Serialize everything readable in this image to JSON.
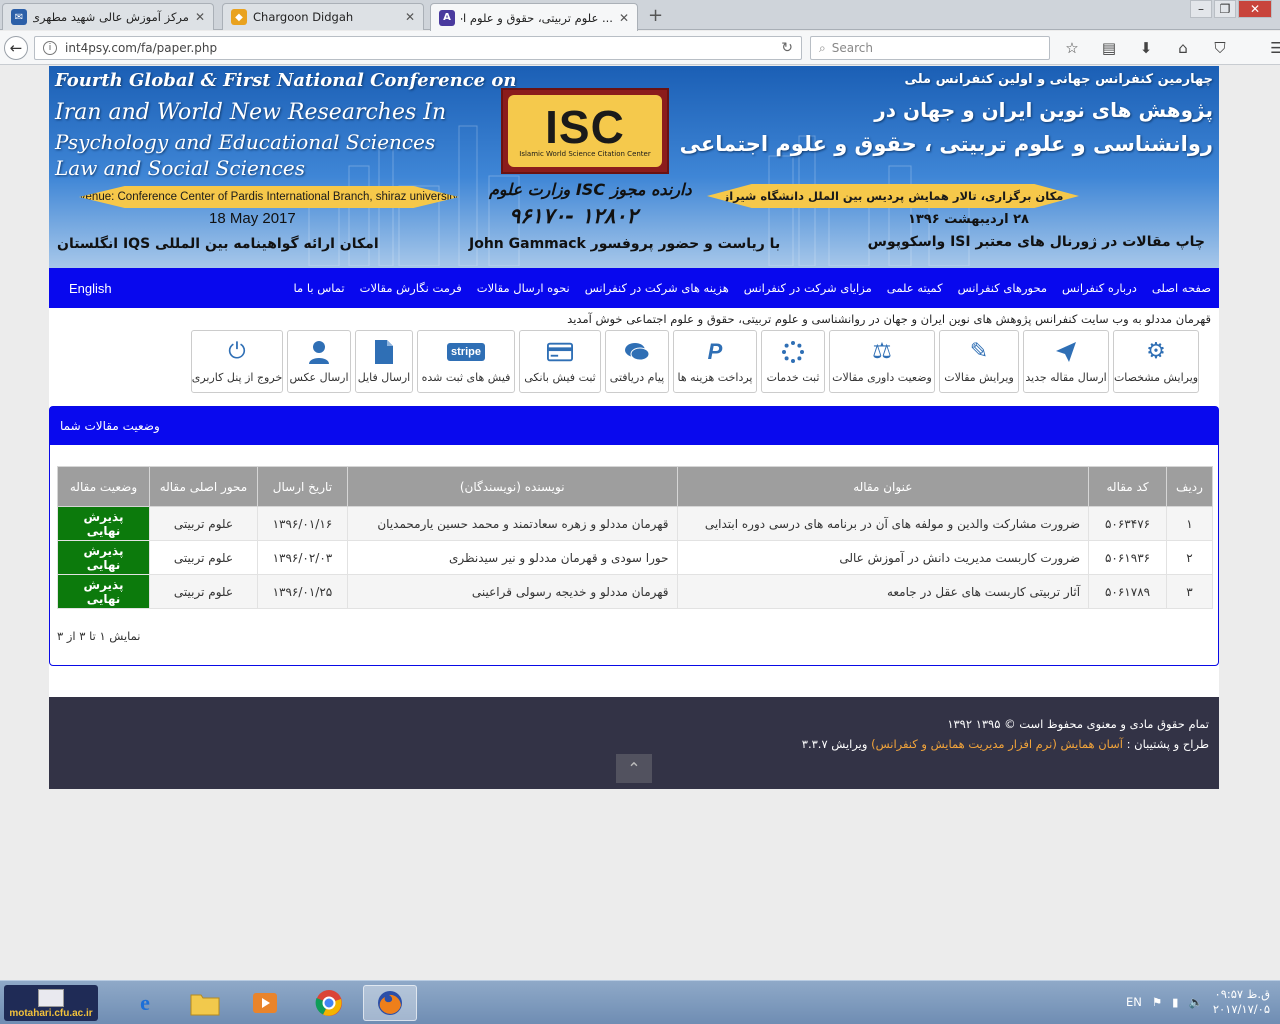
{
  "browser": {
    "tabs": [
      {
        "title": "مرکز آموزش عالی شهید مطهری خوی"
      },
      {
        "title": "Chargoon Didgah"
      },
      {
        "title": "... علوم تربیتی، حقوق و علوم اجتماعی",
        "active": true
      }
    ],
    "url": "int4psy.com/fa/paper.php",
    "search_placeholder": "Search"
  },
  "banner": {
    "en_line1": "Fourth Global & First National Conference on",
    "en_line2": "Iran and World New Researches In",
    "en_line3": "Psychology and Educational Sciences",
    "en_line4": "Law and Social Sciences",
    "en_venue": "venue: Conference Center of Pardis International Branch, shiraz university",
    "en_date": "18 May 2017",
    "iqs": "امکان ارائه گواهینامه بین المللی IQS انگلستان",
    "logo_text": "ISC",
    "logo_sub": "Islamic World Science Citation Center",
    "fa_line1": "چهارمین کنفرانس جهانی و اولین کنفرانس ملی",
    "fa_line2": "پژوهش های نوین ایران و جهان در",
    "fa_line3": "روانشناسی و علوم تربیتی ، حقوق و علوم اجتماعی",
    "fa_venue": "مکان برگزاری، تالار همایش  پردیس بین الملل دانشگاه شیراز",
    "fa_date": "۲۸ اردیبهشت ۱۳۹۶",
    "fa_pub": "چاپ مقالات در ژورنال های معتبر ISI واسکوپوس",
    "fa_license": "دارنده مجوز ISC وزارت علوم",
    "fa_license_num": "۱۲۸۰۲ -۹۶۱۷۰",
    "fa_presidency": "با ریاست و حضور پروفسور John Gammack"
  },
  "mainnav": {
    "english": "English",
    "items": [
      "صفحه اصلی",
      "درباره کنفرانس",
      "محورهای کنفرانس",
      "کمیته علمی",
      "مزایای شرکت در کنفرانس",
      "هزینه های شرکت در کنفرانس",
      "نحوه ارسال مقالات",
      "فرمت نگارش مقالات",
      "تماس با ما"
    ]
  },
  "welcome": "قهرمان مددلو به وب سایت کنفرانس پژوهش های نوین ایران و جهان در روانشناسی و علوم تربیتی، حقوق و علوم اجتماعی خوش آمدید",
  "actions": [
    {
      "label": "ویرایش مشخصات",
      "icon": "gear-icon"
    },
    {
      "label": "ارسال مقاله جدید",
      "icon": "paper-plane-icon"
    },
    {
      "label": "ویرایش مقالات",
      "icon": "edit-icon"
    },
    {
      "label": "وضعیت داوری مقالات",
      "icon": "balance-scale-icon"
    },
    {
      "label": "ثبت خدمات",
      "icon": "spinner-icon"
    },
    {
      "label": "پرداخت هزینه ها",
      "icon": "paypal-icon"
    },
    {
      "label": "پیام دریافتی",
      "icon": "chat-icon"
    },
    {
      "label": "ثبت فیش بانکی",
      "icon": "credit-card-icon"
    },
    {
      "label": "فیش های ثبت شده",
      "icon": "stripe-icon",
      "badge": "stripe"
    },
    {
      "label": "ارسال فایل",
      "icon": "file-icon"
    },
    {
      "label": "ارسال عکس",
      "icon": "user-icon"
    },
    {
      "label": "خروج از پنل کاربری",
      "icon": "power-icon"
    }
  ],
  "panel": {
    "title": "وضعیت مقالات شما",
    "columns": [
      "ردیف",
      "کد مقاله",
      "عنوان مقاله",
      "نویسنده (نویسندگان)",
      "تاریخ ارسال",
      "محور اصلی مقاله",
      "وضعیت مقاله"
    ],
    "rows": [
      [
        "۱",
        "۵۰۶۳۴۷۶",
        "ضرورت مشارکت والدین و مولفه های آن در برنامه های درسی دوره ابتدایی",
        "قهرمان مددلو و زهره سعادتمند و محمد حسین یارمحمدیان",
        "۱۳۹۶/۰۱/۱۶",
        "علوم تربیتی",
        "پذیرش نهایی"
      ],
      [
        "۲",
        "۵۰۶۱۹۳۶",
        "ضرورت کاربست مدیریت دانش در آموزش عالی",
        "حورا سودی و قهرمان مددلو و نیر سیدنظری",
        "۱۳۹۶/۰۲/۰۳",
        "علوم تربیتی",
        "پذیرش نهایی"
      ],
      [
        "۳",
        "۵۰۶۱۷۸۹",
        "آثار تربیتی کاربست های عقل در جامعه",
        "قهرمان مددلو و خدیجه رسولی قراعینی",
        "۱۳۹۶/۰۱/۲۵",
        "علوم تربیتی",
        "پذیرش نهایی"
      ]
    ],
    "pager": "نمایش ۱ تا ۳ از ۳"
  },
  "footer": {
    "copyright": "تمام حقوق مادی و معنوی محفوظ است © ۱۳۹۵   ۱۳۹۲",
    "design_prefix": "طراح و پشتیبان :",
    "design_link": "آسان همایش (نرم افزار مدیریت همایش و کنفرانس)",
    "version": "ویرایش ۳.۳.۷",
    "to_top": "⌃"
  },
  "taskbar": {
    "start_label": "motahari.cfu.ac.ir",
    "lang": "EN",
    "time": "ق.ظ ۰۹:۵۷",
    "date": "۲۰۱۷/۱۷/۰۵"
  },
  "colors": {
    "nav_blue": "#0808ee",
    "accepted_green": "#0c7a0c",
    "footer_dark": "#333346",
    "link_orange": "#f2a43a"
  }
}
